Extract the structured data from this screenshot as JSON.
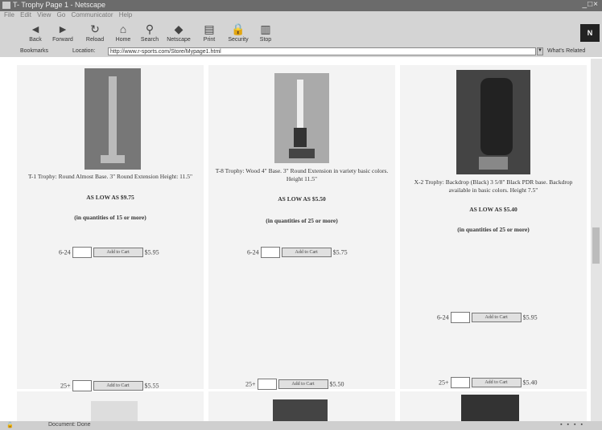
{
  "window": {
    "title": "T- Trophy Page 1 - Netscape",
    "controls": "_□×"
  },
  "menu": [
    "File",
    "Edit",
    "View",
    "Go",
    "Communicator",
    "Help"
  ],
  "toolbar": [
    {
      "label": "Back",
      "icon": "back-arrow-icon",
      "glyph": "◄"
    },
    {
      "label": "Forward",
      "icon": "forward-arrow-icon",
      "glyph": "►"
    },
    {
      "label": "Reload",
      "icon": "reload-icon",
      "glyph": "↻"
    },
    {
      "label": "Home",
      "icon": "home-icon",
      "glyph": "⌂"
    },
    {
      "label": "Search",
      "icon": "search-icon",
      "glyph": "⚲"
    },
    {
      "label": "Netscape",
      "icon": "netscape-icon",
      "glyph": "◆"
    },
    {
      "label": "Print",
      "icon": "print-icon",
      "glyph": "▤"
    },
    {
      "label": "Security",
      "icon": "security-icon",
      "glyph": "🔒"
    },
    {
      "label": "Stop",
      "icon": "stop-icon",
      "glyph": "▥"
    }
  ],
  "brand": "N",
  "location": {
    "bookmarks": "Bookmarks",
    "label": "Location:",
    "url": "http://www.r-sports.com/Store/Mypage1.html",
    "related": "What's Related"
  },
  "products": [
    {
      "description": "T-1 Trophy: Round Almost Base. 3\" Round Extension Height: 11.5\"",
      "price_line": "AS LOW AS $9.75",
      "qty_line": "(in quantities of 15 or more)",
      "tiers": [
        {
          "label": "6-24",
          "price": "$5.95"
        },
        {
          "label": "25+",
          "price": "$5.55"
        }
      ]
    },
    {
      "description": "T-8 Trophy: Wood 4\" Base. 3\" Round Extension in variety basic colors. Height 11.5\"",
      "price_line": "AS LOW AS $5.50",
      "qty_line": "(in quantities of 25 or more)",
      "tiers": [
        {
          "label": "6-24",
          "price": "$5.75"
        },
        {
          "label": "25+",
          "price": "$5.50"
        }
      ]
    },
    {
      "description": "X-2 Trophy: Backdrop (Black) 3 5/8\" Black PDR base. Backdrop available in basic colors. Height 7.5\"",
      "price_line": "AS LOW AS $5.40",
      "qty_line": "(in quantities of 25 or more)",
      "tiers": [
        {
          "label": "6-24",
          "price": "$5.95"
        },
        {
          "label": "25+",
          "price": "$5.40"
        }
      ]
    }
  ],
  "add_button": "Add to Cart",
  "status": {
    "text": "Document: Done"
  }
}
